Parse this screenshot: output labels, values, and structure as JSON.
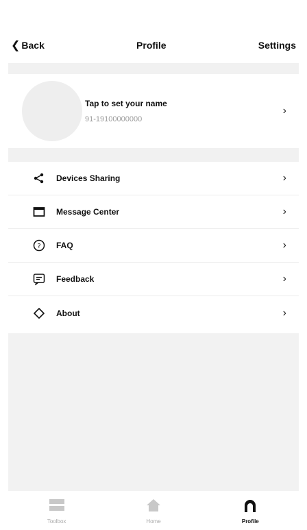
{
  "header": {
    "back_label": "Back",
    "title": "Profile",
    "settings_label": "Settings"
  },
  "profile": {
    "name": "Tap to set your name",
    "phone": "91-19100000000"
  },
  "menu": [
    {
      "label": "Devices Sharing",
      "icon": "share-icon"
    },
    {
      "label": "Message Center",
      "icon": "message-icon"
    },
    {
      "label": "FAQ",
      "icon": "help-icon"
    },
    {
      "label": "Feedback",
      "icon": "feedback-icon"
    },
    {
      "label": "About",
      "icon": "about-icon"
    }
  ],
  "tabs": [
    {
      "label": "Toolbox",
      "icon": "toolbox-icon",
      "active": false
    },
    {
      "label": "Home",
      "icon": "home-icon",
      "active": false
    },
    {
      "label": "Profile",
      "icon": "profile-icon",
      "active": true
    }
  ],
  "colors": {
    "inactive_tab": "#aaaaaa",
    "active_tab": "#111111",
    "separator": "#f1f1f1"
  }
}
